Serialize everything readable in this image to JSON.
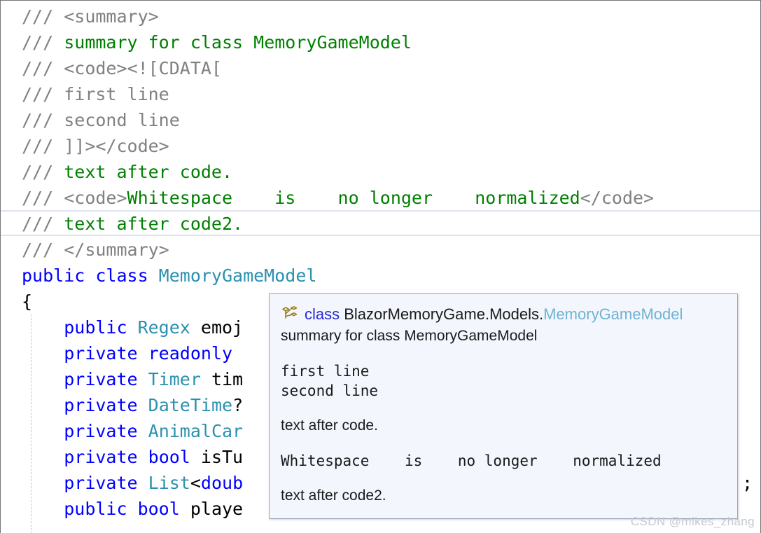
{
  "window": {
    "border_color": "#757575",
    "background": "#ffffff"
  },
  "editor": {
    "font_size_px": 25,
    "line_height_px": 37,
    "colors": {
      "doc_comment_tag": "#808080",
      "doc_comment_text": "#008000",
      "keyword": "#0000ff",
      "type": "#2b91af",
      "plain_text": "#000000",
      "current_line_band": "#dfe3ee",
      "indent_guide": "#c8c8c8"
    },
    "current_line_index": 9,
    "lines": [
      {
        "indent": "",
        "tag": "/// ",
        "seg": "<summary>",
        "style": "doc"
      },
      {
        "indent": "",
        "tag": "/// ",
        "seg": "summary for class MemoryGameModel",
        "style": "doctext"
      },
      {
        "indent": "",
        "tag": "/// ",
        "seg": "<code><![CDATA[",
        "style": "doc"
      },
      {
        "indent": "",
        "tag": "/// ",
        "seg": "first line",
        "style": "doc"
      },
      {
        "indent": "",
        "tag": "/// ",
        "seg": "second line",
        "style": "doc"
      },
      {
        "indent": "",
        "tag": "/// ",
        "seg": "]]></code>",
        "style": "doc"
      },
      {
        "indent": "",
        "tag": "/// ",
        "seg": "text after code.",
        "style": "doctext"
      },
      {
        "indent": "",
        "tag": "/// ",
        "seg": "",
        "style": "mixedcode"
      },
      {
        "indent": "",
        "tag": "/// ",
        "seg": "text after code2.",
        "style": "doctext"
      },
      {
        "indent": "",
        "tag": "/// ",
        "seg": "</summary>",
        "style": "doc"
      }
    ],
    "whitespace_line": {
      "tag": "/// ",
      "open_tag": "<code>",
      "content": "Whitespace    is    no longer    normalized",
      "close_tag": "</code>"
    },
    "code_lines": [
      {
        "text_parts": [
          {
            "t": "public ",
            "c": "kw"
          },
          {
            "t": "class ",
            "c": "kw"
          },
          {
            "t": "MemoryGameModel",
            "c": "type"
          }
        ]
      },
      {
        "text_parts": [
          {
            "t": "{",
            "c": "plain"
          }
        ]
      },
      {
        "text_parts": [
          {
            "t": "    ",
            "c": "plain"
          },
          {
            "t": "public ",
            "c": "kw"
          },
          {
            "t": "Regex ",
            "c": "type"
          },
          {
            "t": "emoj",
            "c": "plain"
          }
        ]
      },
      {
        "text_parts": [
          {
            "t": "    ",
            "c": "plain"
          },
          {
            "t": "private readonly ",
            "c": "kw"
          }
        ]
      },
      {
        "text_parts": [
          {
            "t": "    ",
            "c": "plain"
          },
          {
            "t": "private ",
            "c": "kw"
          },
          {
            "t": "Timer ",
            "c": "type"
          },
          {
            "t": "tim",
            "c": "plain"
          }
        ]
      },
      {
        "text_parts": [
          {
            "t": "    ",
            "c": "plain"
          },
          {
            "t": "private ",
            "c": "kw"
          },
          {
            "t": "DateTime",
            "c": "type"
          },
          {
            "t": "?",
            "c": "plain"
          }
        ]
      },
      {
        "text_parts": [
          {
            "t": "    ",
            "c": "plain"
          },
          {
            "t": "private ",
            "c": "kw"
          },
          {
            "t": "AnimalCar",
            "c": "type"
          }
        ]
      },
      {
        "text_parts": [
          {
            "t": "    ",
            "c": "plain"
          },
          {
            "t": "private ",
            "c": "kw"
          },
          {
            "t": "bool ",
            "c": "kw"
          },
          {
            "t": "isTu",
            "c": "plain"
          }
        ]
      },
      {
        "text_parts": [
          {
            "t": "    ",
            "c": "plain"
          },
          {
            "t": "private ",
            "c": "kw"
          },
          {
            "t": "List",
            "c": "type"
          },
          {
            "t": "<",
            "c": "plain"
          },
          {
            "t": "doub",
            "c": "kw"
          }
        ]
      },
      {
        "text_parts": [
          {
            "t": "    ",
            "c": "plain"
          },
          {
            "t": "public ",
            "c": "kw"
          },
          {
            "t": "bool ",
            "c": "kw"
          },
          {
            "t": "playe",
            "c": "plain"
          }
        ]
      }
    ],
    "trailing_semicolon": ";"
  },
  "tooltip": {
    "icon": "class-icon",
    "icon_color": "#9a7d16",
    "background": "#f3f6fd",
    "border_color": "#9aa5b8",
    "header": {
      "keyword": "class",
      "namespace": "BlazorMemoryGame.Models.",
      "type_name": "MemoryGameModel"
    },
    "summary": "summary for class MemoryGameModel",
    "code_block_1": "first line\nsecond line",
    "para_1": "text after code.",
    "code_block_2": "Whitespace    is    no longer    normalized",
    "para_2": "text after code2."
  },
  "watermark": {
    "text": "CSDN @mikes_zhang"
  }
}
